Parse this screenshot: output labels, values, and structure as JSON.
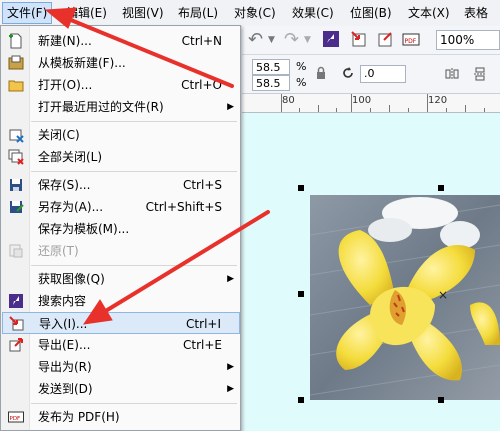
{
  "menubar": {
    "items": [
      "文件(F)",
      "编辑(E)",
      "视图(V)",
      "布局(L)",
      "对象(C)",
      "效果(C)",
      "位图(B)",
      "文本(X)",
      "表格(T"
    ]
  },
  "toolbar": {
    "zoom": "100%",
    "width_value": "58.5",
    "height_value": "58.5",
    "percent_symbol": "%",
    "rotation_value": ".0",
    "undo_symbol": "↶",
    "redo_symbol": "↷"
  },
  "ruler": {
    "labels": [
      "80",
      "100",
      "120"
    ]
  },
  "file_menu": {
    "items": [
      {
        "label": "新建(N)...",
        "shortcut": "Ctrl+N",
        "icon": "new-doc-icon"
      },
      {
        "label": "从模板新建(F)...",
        "shortcut": "",
        "icon": "template-icon"
      },
      {
        "label": "打开(O)...",
        "shortcut": "Ctrl+O",
        "icon": "open-folder-icon"
      },
      {
        "label": "打开最近用过的文件(R)",
        "shortcut": "",
        "submenu": true
      },
      {
        "label": "关闭(C)",
        "shortcut": "",
        "icon": "close-doc-icon"
      },
      {
        "label": "全部关闭(L)",
        "shortcut": "",
        "icon": "close-all-icon"
      },
      {
        "label": "保存(S)...",
        "shortcut": "Ctrl+S",
        "icon": "save-icon"
      },
      {
        "label": "另存为(A)...",
        "shortcut": "Ctrl+Shift+S",
        "icon": "save-as-icon"
      },
      {
        "label": "保存为模板(M)...",
        "shortcut": "",
        "icon": ""
      },
      {
        "label": "还原(T)",
        "shortcut": "",
        "icon": "revert-icon",
        "disabled": true
      },
      {
        "label": "获取图像(Q)",
        "shortcut": "",
        "submenu": true
      },
      {
        "label": "搜索内容",
        "shortcut": "",
        "icon": "search-content-icon"
      },
      {
        "label": "导入(I)...",
        "shortcut": "Ctrl+I",
        "icon": "import-icon",
        "highlighted": true
      },
      {
        "label": "导出(E)...",
        "shortcut": "Ctrl+E",
        "icon": "export-icon"
      },
      {
        "label": "导出为(R)",
        "shortcut": "",
        "submenu": true
      },
      {
        "label": "发送到(D)",
        "shortcut": "",
        "submenu": true
      },
      {
        "label": "发布为 PDF(H)",
        "shortcut": "",
        "icon": "pdf-icon"
      }
    ],
    "submenu_arrow": "▶"
  },
  "colors": {
    "highlight": "#dbe9f9",
    "annotation_arrow": "#e8312b",
    "canvas": "#e0fbfb",
    "brand_purple": "#4b2e8c"
  }
}
